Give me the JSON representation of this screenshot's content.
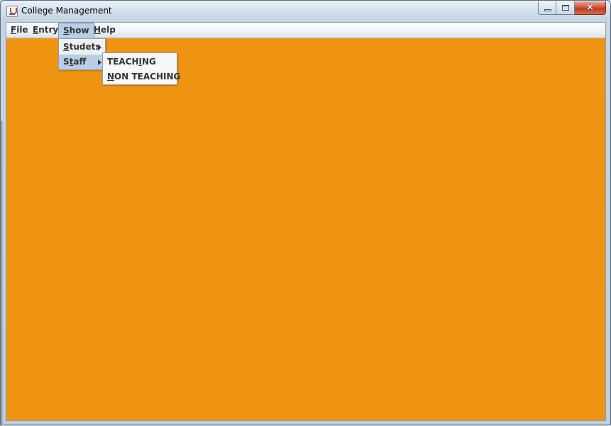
{
  "window": {
    "title": "College Management",
    "icon": "java-cup-icon",
    "controls": {
      "minimize": "minimize-icon",
      "maximize": "maximize-icon",
      "close": "×"
    }
  },
  "menubar": {
    "file": {
      "pre": "",
      "mn": "F",
      "post": "ile"
    },
    "entry": {
      "pre": "",
      "mn": "E",
      "post": "ntry"
    },
    "show": {
      "pre": "",
      "mn": "S",
      "post": "how"
    },
    "help": {
      "pre": "",
      "mn": "H",
      "post": "elp"
    }
  },
  "show_menu": {
    "items": [
      {
        "pre": "",
        "mn": "S",
        "post": "tudets"
      },
      {
        "pre": "S",
        "mn": "t",
        "post": "aff"
      }
    ]
  },
  "staff_menu": {
    "items": [
      {
        "pre": "TEACH",
        "mn": "I",
        "post": "NG"
      },
      {
        "pre": "",
        "mn": "N",
        "post": "ON TEACHING"
      }
    ]
  },
  "colors": {
    "content_background": "#ef9410",
    "menu_highlight": "#b8cfe5"
  }
}
